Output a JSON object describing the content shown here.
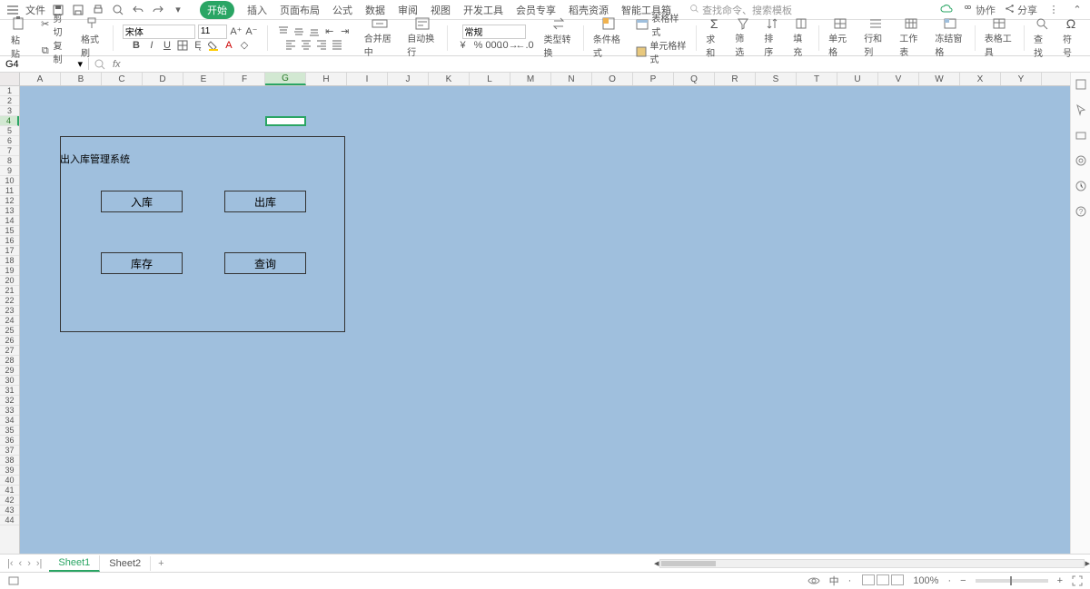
{
  "menu": {
    "file": "文件",
    "tabs": [
      "开始",
      "插入",
      "页面布局",
      "公式",
      "数据",
      "审阅",
      "视图",
      "开发工具",
      "会员专享",
      "稻壳资源",
      "智能工具箱"
    ],
    "active_tab_index": 0,
    "search_placeholder": "查找命令、搜索模板",
    "collab": "协作",
    "share": "分享"
  },
  "ribbon": {
    "cut": "剪切",
    "paste": "粘贴",
    "copy": "复制",
    "format_painter": "格式刷",
    "font_name": "宋体",
    "font_size": "11",
    "merge_center": "合并居中",
    "wrap_text": "自动换行",
    "number_format": "常规",
    "type_convert": "类型转换",
    "cond_format": "条件格式",
    "table_style": "表格样式",
    "cell_style": "单元格样式",
    "sum": "求和",
    "filter": "筛选",
    "sort": "排序",
    "fill": "填充",
    "cell": "单元格",
    "rowcol": "行和列",
    "worksheet": "工作表",
    "freeze": "冻结窗格",
    "tabletools": "表格工具",
    "find": "查找",
    "symbol": "符号"
  },
  "formula": {
    "namebox": "G4",
    "fx": "fx"
  },
  "columns": [
    "A",
    "B",
    "C",
    "D",
    "E",
    "F",
    "G",
    "H",
    "I",
    "J",
    "K",
    "L",
    "M",
    "N",
    "O",
    "P",
    "Q",
    "R",
    "S",
    "T",
    "U",
    "V",
    "W",
    "X",
    "Y"
  ],
  "selected_col": "G",
  "selected_row": 4,
  "panel": {
    "title": "出入库管理系统",
    "btn_in": "入库",
    "btn_out": "出库",
    "btn_stock": "库存",
    "btn_query": "查询"
  },
  "sheet_tabs": {
    "tabs": [
      "Sheet1",
      "Sheet2"
    ],
    "active": 0
  },
  "status": {
    "ime": "中",
    "zoom": "100%",
    "more": "•••"
  }
}
